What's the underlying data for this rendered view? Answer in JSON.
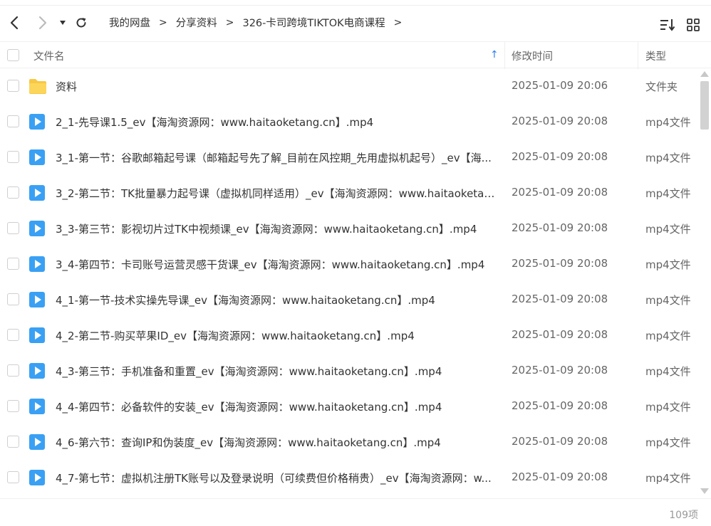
{
  "nav": {
    "back_icon": "chevron-left-icon",
    "forward_icon": "chevron-right-icon",
    "dropdown_icon": "caret-down-icon",
    "refresh_icon": "refresh-icon"
  },
  "breadcrumb": [
    {
      "label": "我的网盘"
    },
    {
      "label": "分享资料"
    },
    {
      "label": "326-卡司跨境TIKTOK电商课程"
    }
  ],
  "toolbar": {
    "sort_icon": "sort-list-icon",
    "grid_icon": "grid-view-icon"
  },
  "columns": {
    "name": "文件名",
    "time": "修改时间",
    "type": "类型",
    "sort_indicator": "↑"
  },
  "colors": {
    "accent": "#2a7ff5",
    "folder": "#f7c844",
    "video": "#3aa0f4"
  },
  "files": [
    {
      "name": "资料",
      "time": "2025-01-09 20:06",
      "type": "文件夹",
      "kind": "folder"
    },
    {
      "name": "2_1-先导课1.5_ev【海淘资源网：www.haitaoketang.cn】.mp4",
      "time": "2025-01-09 20:08",
      "type": "mp4文件",
      "kind": "video"
    },
    {
      "name": "3_1-第一节：谷歌邮箱起号课（邮箱起号先了解_目前在风控期_先用虚拟机起号）_ev【海...",
      "time": "2025-01-09 20:08",
      "type": "mp4文件",
      "kind": "video"
    },
    {
      "name": "3_2-第二节：TK批量暴力起号课（虚拟机同样适用）_ev【海淘资源网：www.haitaoketan...",
      "time": "2025-01-09 20:08",
      "type": "mp4文件",
      "kind": "video"
    },
    {
      "name": "3_3-第三节：影视切片过TK中视频课_ev【海淘资源网：www.haitaoketang.cn】.mp4",
      "time": "2025-01-09 20:08",
      "type": "mp4文件",
      "kind": "video"
    },
    {
      "name": "3_4-第四节：卡司账号运营灵感干货课_ev【海淘资源网：www.haitaoketang.cn】.mp4",
      "time": "2025-01-09 20:08",
      "type": "mp4文件",
      "kind": "video"
    },
    {
      "name": "4_1-第一节-技术实操先导课_ev【海淘资源网：www.haitaoketang.cn】.mp4",
      "time": "2025-01-09 20:08",
      "type": "mp4文件",
      "kind": "video"
    },
    {
      "name": "4_2-第二节-购买苹果ID_ev【海淘资源网：www.haitaoketang.cn】.mp4",
      "time": "2025-01-09 20:08",
      "type": "mp4文件",
      "kind": "video"
    },
    {
      "name": "4_3-第三节：手机准备和重置_ev【海淘资源网：www.haitaoketang.cn】.mp4",
      "time": "2025-01-09 20:08",
      "type": "mp4文件",
      "kind": "video"
    },
    {
      "name": "4_4-第四节：必备软件的安装_ev【海淘资源网：www.haitaoketang.cn】.mp4",
      "time": "2025-01-09 20:08",
      "type": "mp4文件",
      "kind": "video"
    },
    {
      "name": "4_6-第六节：查询IP和伪装度_ev【海淘资源网：www.haitaoketang.cn】.mp4",
      "time": "2025-01-09 20:08",
      "type": "mp4文件",
      "kind": "video"
    },
    {
      "name": "4_7-第七节：虚拟机注册TK账号以及登录说明（可续费但价格稍贵）_ev【海淘资源网：w...",
      "time": "2025-01-09 20:08",
      "type": "mp4文件",
      "kind": "video"
    }
  ],
  "footer": {
    "count": "109项"
  }
}
